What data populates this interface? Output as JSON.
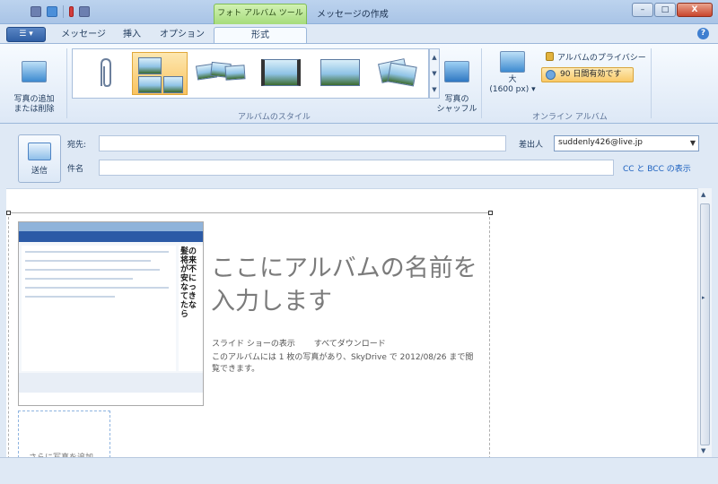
{
  "titlebar": {
    "context_tab": "フォト アルバム ツール",
    "window_title": "メッセージの作成",
    "minimize": "–",
    "maximize": "□",
    "close": "X"
  },
  "tabs": [
    {
      "label": "メッセージ",
      "active": false
    },
    {
      "label": "挿入",
      "active": false
    },
    {
      "label": "オプション",
      "active": false
    },
    {
      "label": "形式",
      "active": true
    }
  ],
  "help_icon": "?",
  "ribbon": {
    "add_remove_photos": "写真の追加\nまたは削除",
    "album_style_group": "アルバムのスタイル",
    "shuffle_photos": "写真の\nシャッフル",
    "size_label": "大",
    "size_value": "(1600 px)",
    "online_album_group": "オンライン アルバム",
    "privacy_label": "アルバムのプライバシー",
    "expire_label": "90 日間有効です"
  },
  "header": {
    "send_label": "送信",
    "to_label": "宛先:",
    "to_value": "",
    "subject_label": "件名",
    "subject_value": "",
    "from_label": "差出人",
    "from_value": "suddenly426@live.jp",
    "cc_bcc_link": "CC と BCC の表示"
  },
  "album": {
    "title_placeholder": "ここにアルバムの名前を入力します",
    "slideshow_link": "スライド ショーの表示",
    "download_all_link": "すべてダウンロード",
    "description": "このアルバムには 1 枚の写真があり、SkyDrive で 2012/08/26 まで閲覧できます。",
    "add_photo_label": "さらに写真を追加",
    "thumbnail_ad_text": "髪の将来が不安になってきたなら"
  },
  "icons": [
    "paperclip-icon",
    "photo-icon",
    "shuffle-icon",
    "lock-icon",
    "clock-icon",
    "send-icon",
    "help-icon"
  ]
}
